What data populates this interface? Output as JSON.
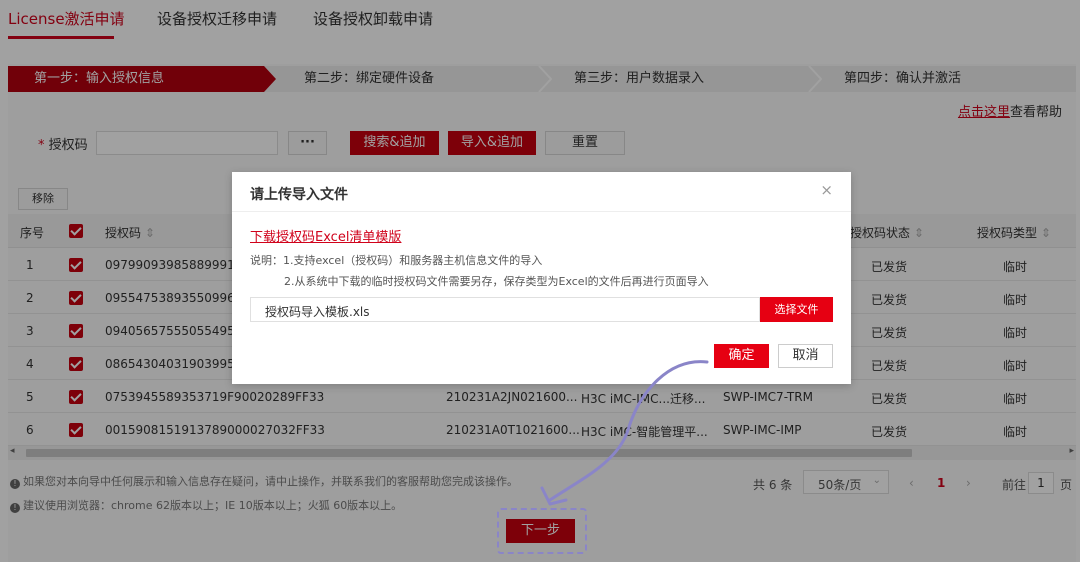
{
  "tabs": [
    "License激活申请",
    "设备授权迁移申请",
    "设备授权卸载申请"
  ],
  "steps": [
    "第一步：输入授权信息",
    "第二步：绑定硬件设备",
    "第三步：用户数据录入",
    "第四步：确认并激活"
  ],
  "help": {
    "link": "点击这里",
    "text": "查看帮助"
  },
  "form": {
    "label": "授权码",
    "required_mark": "*",
    "input_value": "",
    "more_label": "···",
    "search_label": "搜索&追加",
    "import_label": "导入&追加",
    "reset_label": "重置"
  },
  "table": {
    "remove_label": "移除",
    "headers": [
      "序号",
      "授权码",
      "授权码状态",
      "授权码类型"
    ],
    "rows": [
      {
        "no": "1",
        "code": "0979909398588999123",
        "sn": "",
        "product": "",
        "model": "",
        "status": "已发货",
        "type": "临时"
      },
      {
        "no": "2",
        "code": "0955475389355099635",
        "sn": "",
        "product": "",
        "model": "",
        "status": "已发货",
        "type": "临时"
      },
      {
        "no": "3",
        "code": "0940565755505549513",
        "sn": "",
        "product": "",
        "model": "",
        "status": "已发货",
        "type": "临时"
      },
      {
        "no": "4",
        "code": "0865430403190399523",
        "sn": "",
        "product": "",
        "model": "",
        "status": "已发货",
        "type": "临时"
      },
      {
        "no": "5",
        "code": "0753945589353719F90020289FF33",
        "sn": "210231A2JN021600...",
        "product": "H3C iMC-IMC...迁移...",
        "model": "SWP-IMC7-TRM",
        "status": "已发货",
        "type": "临时"
      },
      {
        "no": "6",
        "code": "0015908151913789000027032FF33",
        "sn": "210231A0T1021600...",
        "product": "H3C iMC-智能管理平...",
        "model": "SWP-IMC-IMP",
        "status": "已发货",
        "type": "临时"
      }
    ]
  },
  "notes": [
    "如果您对本向导中任何展示和输入信息存在疑问，请中止操作，并联系我们的客服帮助您完成该操作。",
    "建议使用浏览器：chrome 62版本以上；IE 10版本以上；火狐 60版本以上。"
  ],
  "pager": {
    "total": "共 6 条",
    "page_size": "50条/页",
    "current_page": "1",
    "goto_label": "前往",
    "goto_value": "1",
    "page_suffix": "页"
  },
  "next_label": "下一步",
  "modal": {
    "title": "请上传导入文件",
    "close": "×",
    "template_link": "下载授权码Excel清单模版",
    "desc_line1": "说明：1.支持excel（授权码）和服务器主机信息文件的导入",
    "desc_line2": "2.从系统中下载的临时授权码文件需要另存，保存类型为Excel的文件后再进行页面导入",
    "file_name": "授权码导入模板.xls",
    "choose_label": "选择文件",
    "ok_label": "确定",
    "cancel_label": "取消"
  },
  "colors": {
    "accent": "#d0021b",
    "button_red": "#e60012",
    "annotation": "#8a85c8"
  }
}
